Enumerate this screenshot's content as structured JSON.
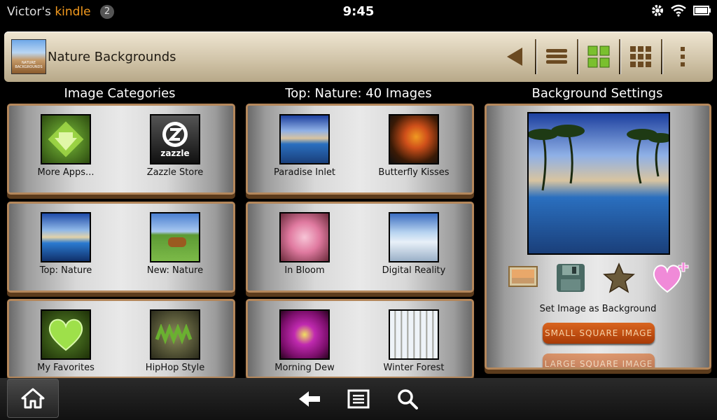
{
  "status": {
    "owner": "Victor's",
    "brand": "kindle",
    "badge": "2",
    "time": "9:45"
  },
  "app": {
    "title": "Nature Backgrounds",
    "icon_text": "NATURE BACKGROUNDS"
  },
  "columns": {
    "categories": "Image Categories",
    "top": "Top: Nature: 40 Images",
    "settings": "Background Settings"
  },
  "categories": [
    {
      "label": "More Apps...",
      "icon": "download-arrow-icon"
    },
    {
      "label": "Zazzle Store",
      "icon": "zazzle-logo-icon"
    },
    {
      "label": "Top: Nature",
      "icon": "top-nature-thumbnail"
    },
    {
      "label": "New: Nature",
      "icon": "horse-thumbnail"
    },
    {
      "label": "My Favorites",
      "icon": "heart-icon"
    },
    {
      "label": "HipHop Style",
      "icon": "graffiti-thumbnail"
    }
  ],
  "zazzle_logo_text": "zazzle",
  "images": [
    {
      "label": "Paradise Inlet"
    },
    {
      "label": "Butterfly Kisses"
    },
    {
      "label": "In Bloom"
    },
    {
      "label": "Digital Reality"
    },
    {
      "label": "Morning Dew"
    },
    {
      "label": "Winter Forest"
    }
  ],
  "settings": {
    "set_label": "Set Image as Background",
    "small_button": "SMALL SQUARE IMAGE",
    "large_button": "LARGE SQUARE IMAGE"
  },
  "colors": {
    "accent": "#f39a1e",
    "panel_border": "#b4875b",
    "button_orange": "#c24e12"
  }
}
